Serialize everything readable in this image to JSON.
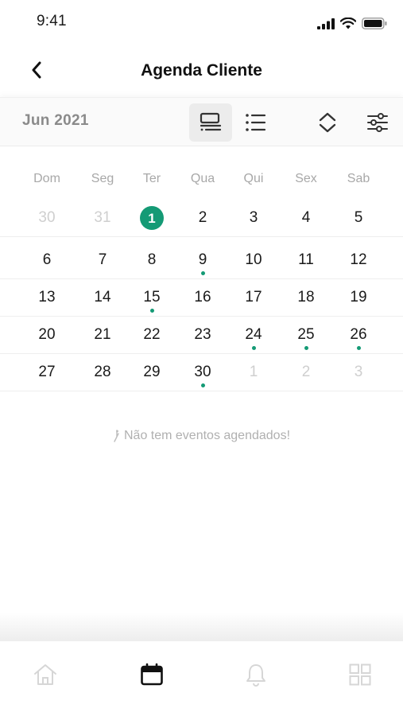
{
  "status_bar": {
    "time": "9:41"
  },
  "header": {
    "title": "Agenda Cliente"
  },
  "toolbar": {
    "month": "Jun 2021"
  },
  "weekdays": [
    "Dom",
    "Seg",
    "Ter",
    "Qua",
    "Qui",
    "Sex",
    "Sab"
  ],
  "weeks": [
    [
      {
        "day": "30",
        "muted": true
      },
      {
        "day": "31",
        "muted": true
      },
      {
        "day": "1",
        "today": true
      },
      {
        "day": "2"
      },
      {
        "day": "3"
      },
      {
        "day": "4"
      },
      {
        "day": "5"
      }
    ],
    [
      {
        "day": "6"
      },
      {
        "day": "7"
      },
      {
        "day": "8"
      },
      {
        "day": "9",
        "event": true
      },
      {
        "day": "10"
      },
      {
        "day": "11"
      },
      {
        "day": "12"
      }
    ],
    [
      {
        "day": "13"
      },
      {
        "day": "14"
      },
      {
        "day": "15",
        "event": true
      },
      {
        "day": "16"
      },
      {
        "day": "17"
      },
      {
        "day": "18"
      },
      {
        "day": "19"
      }
    ],
    [
      {
        "day": "20"
      },
      {
        "day": "21"
      },
      {
        "day": "22"
      },
      {
        "day": "23"
      },
      {
        "day": "24",
        "event": true
      },
      {
        "day": "25",
        "event": true
      },
      {
        "day": "26",
        "event": true
      }
    ],
    [
      {
        "day": "27"
      },
      {
        "day": "28"
      },
      {
        "day": "29"
      },
      {
        "day": "30",
        "event": true
      },
      {
        "day": "1",
        "muted": true
      },
      {
        "day": "2",
        "muted": true
      },
      {
        "day": "3",
        "muted": true
      }
    ]
  ],
  "empty_message": "Não tem eventos agendados!",
  "colors": {
    "accent": "#149a75",
    "muted_text": "#cfcfcf"
  },
  "icons": {
    "back": "chevron-left-icon",
    "calendar_view": "calendar-view-icon",
    "list_view": "list-view-icon",
    "expand_collapse": "chevron-up-down-icon",
    "filter": "sliders-icon",
    "nav": [
      "home-icon",
      "calendar-icon",
      "bell-icon",
      "grid-icon"
    ]
  },
  "bottom_nav": {
    "active_index": 1
  }
}
